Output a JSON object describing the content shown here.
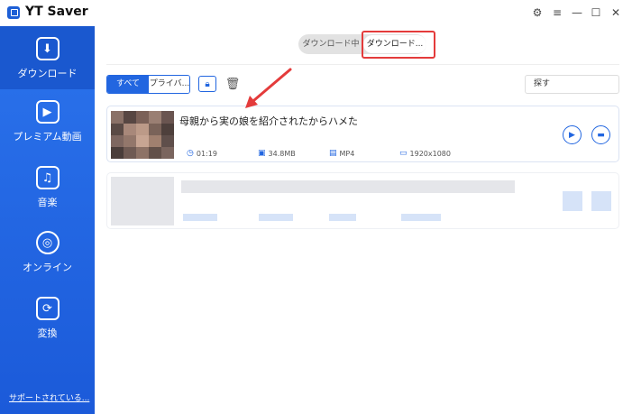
{
  "window": {
    "title": "YT Saver",
    "controls": [
      "gear-icon",
      "menu-icon",
      "minimize-icon",
      "maximize-icon",
      "close-icon"
    ]
  },
  "sidebar": {
    "items": [
      {
        "label": "ダウンロード",
        "icon": "download-icon",
        "active": true
      },
      {
        "label": "プレミアム動画",
        "icon": "play-icon",
        "active": false
      },
      {
        "label": "音楽",
        "icon": "music-icon",
        "active": false
      },
      {
        "label": "オンライン",
        "icon": "globe-icon",
        "active": false
      },
      {
        "label": "変換",
        "icon": "convert-icon",
        "active": false
      }
    ],
    "support_link": "サポートされている..."
  },
  "tabs": {
    "downloading": "ダウンロード中",
    "downloaded": "ダウンロード..."
  },
  "filters": {
    "all": "すべて",
    "private": "プライバ..."
  },
  "search": {
    "placeholder": "探す"
  },
  "items": [
    {
      "title": "母親から実の娘を紹介されたからハメた",
      "duration": "01:19",
      "size": "34.8MB",
      "format": "MP4",
      "resolution": "1920x1080"
    }
  ],
  "colors": {
    "accent": "#2266e0",
    "sidebar": "#1b5ad9",
    "highlight": "#e43b3b"
  }
}
